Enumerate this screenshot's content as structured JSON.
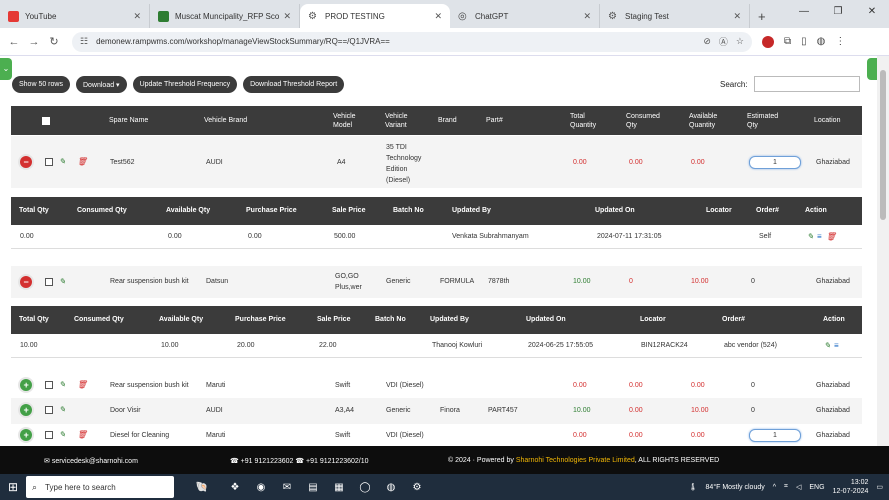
{
  "browser": {
    "tabs": [
      {
        "label": "YouTube",
        "color": "#e53935"
      },
      {
        "label": "Muscat Muncipality_RFP Sco",
        "color": "#2e7d32"
      },
      {
        "label": "PROD TESTING",
        "color": "#555555",
        "active": true
      },
      {
        "label": "ChatGPT",
        "color": "#444444"
      },
      {
        "label": "Staging Test",
        "color": "#555555"
      }
    ],
    "url": "demonew.rampwms.com/workshop/manageViewStockSummary/RQ==/Q1JVRA=="
  },
  "toolbar": {
    "show_rows": "Show 50 rows",
    "download": "Download ▾",
    "update_threshold": "Update Threshold Frequency",
    "download_threshold": "Download Threshold Report",
    "search_label": "Search:"
  },
  "table": {
    "headers": {
      "spare_name": "Spare Name",
      "vehicle_brand": "Vehicle Brand",
      "vehicle_model": "Vehicle Model",
      "vehicle_variant": "Vehicle Variant",
      "brand": "Brand",
      "part": "Part#",
      "total_qty": "Total Quantity",
      "consumed_qty": "Consumed Qty",
      "available_qty": "Available Quantity",
      "estimated_qty": "Estimated Qty",
      "location": "Location"
    },
    "rows": [
      {
        "spare": "Test562",
        "vbrand": "AUDI",
        "model": "A4",
        "variant": "35 TDI Technology Edition (Diesel)",
        "brand": "",
        "part": "",
        "total": "0.00",
        "consumed": "0.00",
        "available": "0.00",
        "estimated": "1",
        "location": "Ghaziabad"
      },
      {
        "spare": "Rear suspension bush kit",
        "vbrand": "Datsun",
        "model": "GO,GO Plus,wer",
        "variant": "Generic",
        "brand": "FORMULA",
        "part": "7878th",
        "total": "10.00",
        "consumed": "0",
        "available": "10.00",
        "estimated": "0",
        "location": "Ghaziabad"
      },
      {
        "spare": "Rear suspension bush kit",
        "vbrand": "Maruti",
        "model": "Swift",
        "variant": "VDI (Diesel)",
        "brand": "",
        "part": "",
        "total": "0.00",
        "consumed": "0.00",
        "available": "0.00",
        "estimated": "0",
        "location": "Ghaziabad"
      },
      {
        "spare": "Door Visir",
        "vbrand": "AUDI",
        "model": "A3,A4",
        "variant": "Generic",
        "brand": "Finora",
        "part": "PART457",
        "total": "10.00",
        "consumed": "0.00",
        "available": "10.00",
        "estimated": "0",
        "location": "Ghaziabad"
      },
      {
        "spare": "Diesel for Cleaning",
        "vbrand": "Maruti",
        "model": "Swift",
        "variant": "VDI (Diesel)",
        "brand": "",
        "part": "",
        "total": "0.00",
        "consumed": "0.00",
        "available": "0.00",
        "estimated": "1",
        "location": "Ghaziabad"
      }
    ]
  },
  "subtable": {
    "headers": {
      "total_qty": "Total Qty",
      "consumed_qty": "Consumed Qty",
      "available_qty": "Available Qty",
      "purchase_price": "Purchase Price",
      "sale_price": "Sale Price",
      "batch_no": "Batch No",
      "updated_by": "Updated By",
      "updated_on": "Updated On",
      "locator": "Locator",
      "order": "Order#",
      "action": "Action"
    },
    "detail1": {
      "total": "0.00",
      "consumed": "",
      "available": "0.00",
      "purchase": "0.00",
      "sale": "500.00",
      "batch": "",
      "by": "Venkata Subrahmanyam",
      "on": "2024-07-11 17:31:05",
      "locator": "",
      "order": "Self"
    },
    "detail2": {
      "total": "10.00",
      "consumed": "",
      "available": "10.00",
      "purchase": "20.00",
      "sale": "22.00",
      "batch": "",
      "by": "Thanooj Kowluri",
      "on": "2024-06-25 17:55:05",
      "locator": "BIN12RACK24",
      "order": "abc vendor (524)"
    }
  },
  "footer": {
    "email": "servicedesk@sharnohi.com",
    "phones": "+91 9121223602  ☎ +91 9121223602/10",
    "copyright_prefix": "© 2024 · Powered by ",
    "company": "Sharnohi Technologies Private Limited",
    "copyright_suffix": ", ALL RIGHTS RESERVED"
  },
  "taskbar": {
    "search_placeholder": "Type here to search",
    "weather": "84°F  Mostly cloudy",
    "lang": "ENG",
    "time": "13:02",
    "date": "12-07-2024"
  }
}
